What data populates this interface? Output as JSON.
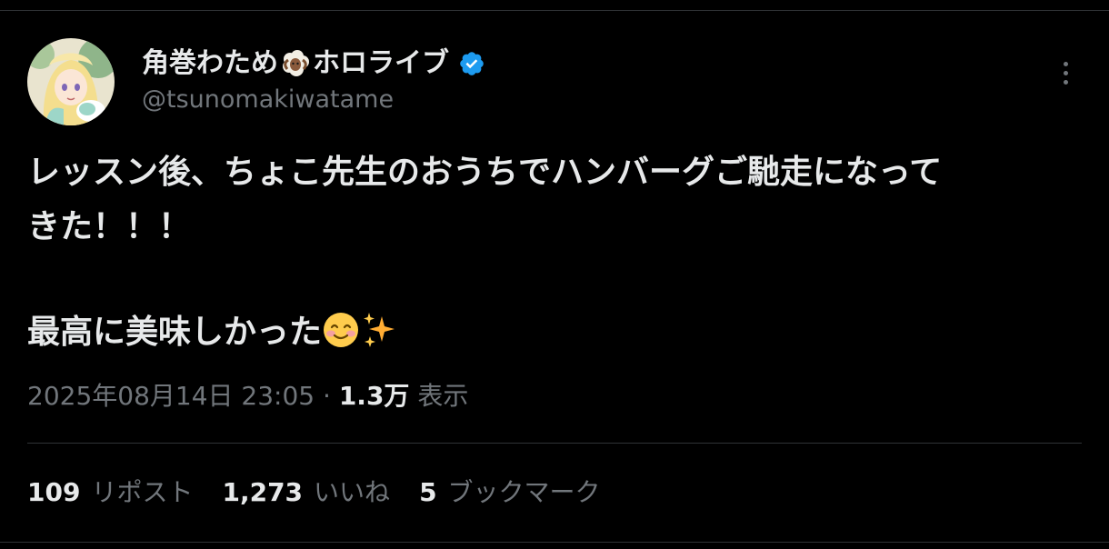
{
  "author": {
    "display_name": "角巻わため",
    "display_name_suffix": "ホロライブ",
    "name_emoji": "sheep-emoji",
    "verified_icon": "verified-badge-icon",
    "handle": "@tsunomakiwatame",
    "avatar": "avatar-image"
  },
  "tweet": {
    "line1": "レッスン後、ちょこ先生のおうちでハンバーグご馳走になって",
    "line2": "きた！！！",
    "line3": "最高に美味しかった",
    "line3_emojis": [
      "smiling-face-emoji",
      "sparkles-emoji"
    ]
  },
  "meta": {
    "timestamp": "2025年08月14日 23:05",
    "separator": "·",
    "views_count": "1.3万",
    "views_label": "表示"
  },
  "stats": {
    "reposts_count": "109",
    "reposts_label": "リポスト",
    "likes_count": "1,273",
    "likes_label": "いいね",
    "bookmarks_count": "5",
    "bookmarks_label": "ブックマーク"
  },
  "colors": {
    "background": "#000000",
    "text_primary": "#e7e9ea",
    "text_secondary": "#71767b",
    "divider": "#2f3336",
    "verified": "#1d9bf0"
  }
}
